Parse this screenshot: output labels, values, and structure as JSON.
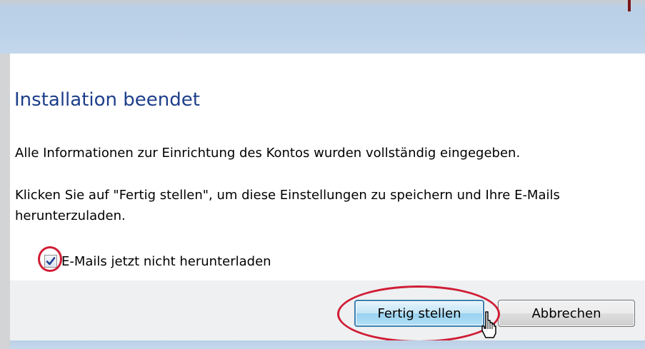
{
  "dialog": {
    "title": "Installation beendet",
    "info_text": "Alle Informationen zur Einrichtung des Kontos wurden vollständig eingegeben.",
    "instruction_line1": "Klicken Sie auf \"Fertig stellen\", um diese Einstellungen zu speichern und Ihre E-Mails",
    "instruction_line2": "herunterzuladen.",
    "checkbox": {
      "label": "E-Mails jetzt nicht herunterladen",
      "checked": true
    },
    "buttons": {
      "finish_label": "Fertig stellen",
      "cancel_label": "Abbrechen"
    }
  },
  "annotations": {
    "highlight_color": "#d01d35"
  },
  "icons": {
    "checkmark": "checkmark-icon",
    "cursor": "hand-pointer-cursor-icon"
  }
}
